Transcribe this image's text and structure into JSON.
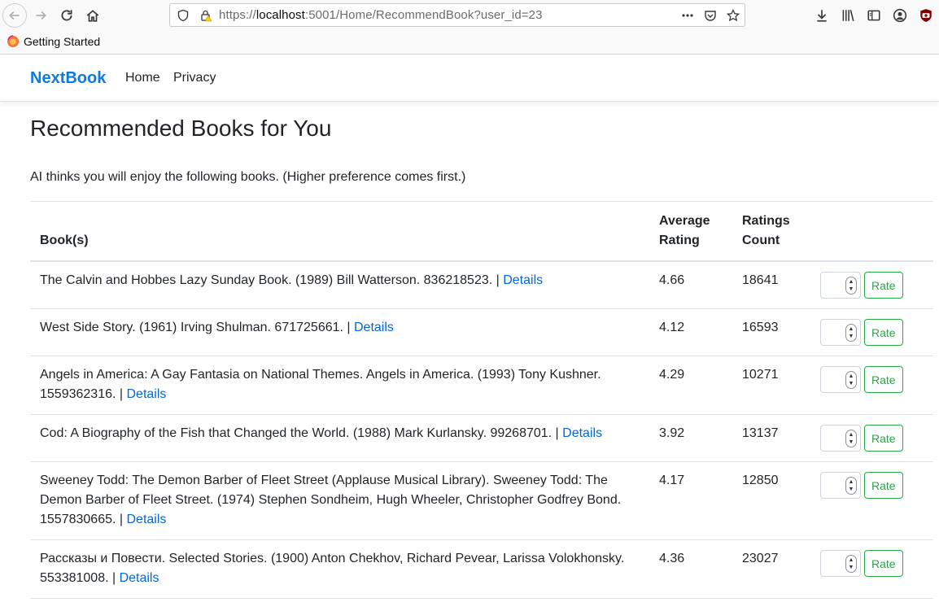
{
  "browser": {
    "url_prefix": "https://",
    "url_host": "localhost",
    "url_rest": ":5001/Home/RecommendBook?user_id=23",
    "bookmark": "Getting Started"
  },
  "nav": {
    "brand": "NextBook",
    "links": [
      "Home",
      "Privacy"
    ]
  },
  "page": {
    "title": "Recommended Books for You",
    "intro": "AI thinks you will enjoy the following books. (Higher preference comes first.)"
  },
  "table": {
    "headers": {
      "book": "Book(s)",
      "avg_line1": "Average",
      "avg_line2": "Rating",
      "count_line1": "Ratings",
      "count_line2": "Count"
    },
    "details_label": "Details",
    "rate_label": "Rate",
    "rows": [
      {
        "text": "The Calvin and Hobbes Lazy Sunday Book. (1989) Bill Watterson. 836218523. | ",
        "avg": "4.66",
        "count": "18641"
      },
      {
        "text": "West Side Story. (1961) Irving Shulman. 671725661. | ",
        "avg": "4.12",
        "count": "16593"
      },
      {
        "text": "Angels in America: A Gay Fantasia on National Themes. Angels in America. (1993) Tony Kushner. 1559362316. | ",
        "avg": "4.29",
        "count": "10271"
      },
      {
        "text": "Cod: A Biography of the Fish that Changed the World. (1988) Mark Kurlansky. 99268701. | ",
        "avg": "3.92",
        "count": "13137"
      },
      {
        "text": "Sweeney Todd: The Demon Barber of Fleet Street (Applause Musical Library). Sweeney Todd: The Demon Barber of Fleet Street. (1974) Stephen Sondheim, Hugh Wheeler, Christopher Godfrey Bond. 1557830665. | ",
        "avg": "4.17",
        "count": "12850"
      },
      {
        "text": "Рассказы и Повести. Selected Stories. (1900) Anton Chekhov, Richard Pevear, Larissa Volokhonsky. 553381008. | ",
        "avg": "4.36",
        "count": "23027"
      }
    ]
  },
  "colors": {
    "brand": "#0c7be3",
    "link": "#0366d6",
    "rate_button": "#28a745"
  }
}
